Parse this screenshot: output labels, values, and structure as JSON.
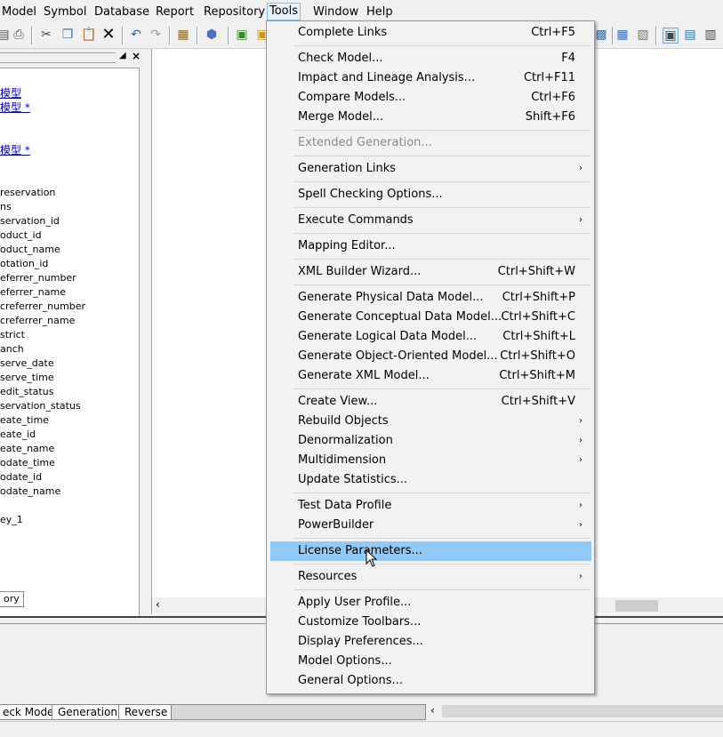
{
  "menubar": {
    "items": [
      "Model",
      "Symbol",
      "Database",
      "Report",
      "Repository",
      "Tools",
      "Window",
      "Help"
    ]
  },
  "left_panel": {
    "tree_items": [
      "模型",
      "模型 *",
      "模型 *",
      "reservation",
      "ns",
      "servation_id",
      "oduct_id",
      "oduct_name",
      "otation_id",
      "eferrer_number",
      "eferrer_name",
      "creferrer_number",
      "creferrer_name",
      "strict",
      "anch",
      "serve_date",
      "serve_time",
      "edit_status",
      "servation_status",
      "eate_time",
      "eate_id",
      "eate_name",
      "odate_time",
      "odate_id",
      "odate_name",
      "ey_1"
    ],
    "tab_label": "ory"
  },
  "bottom_tabs": [
    "eck Model",
    "Generation",
    "Reverse"
  ],
  "tools_menu": {
    "items": [
      {
        "label": "Complete Links",
        "shortcut": "Ctrl+F5"
      },
      {
        "label": "Check Model...",
        "shortcut": "F4"
      },
      {
        "label": "Impact and Lineage Analysis...",
        "shortcut": "Ctrl+F11"
      },
      {
        "label": "Compare Models...",
        "shortcut": "Ctrl+F6"
      },
      {
        "label": "Merge Model...",
        "shortcut": "Shift+F6"
      },
      {
        "label": "Extended Generation...",
        "shortcut": "",
        "disabled": true
      },
      {
        "label": "Generation Links",
        "shortcut": "",
        "submenu": true
      },
      {
        "label": "Spell Checking Options...",
        "shortcut": ""
      },
      {
        "label": "Execute Commands",
        "shortcut": "",
        "submenu": true
      },
      {
        "label": "Mapping Editor...",
        "shortcut": ""
      },
      {
        "label": "XML Builder Wizard...",
        "shortcut": "Ctrl+Shift+W"
      },
      {
        "label": "Generate Physical Data Model...",
        "shortcut": "Ctrl+Shift+P"
      },
      {
        "label": "Generate Conceptual Data Model...",
        "shortcut": "Ctrl+Shift+C"
      },
      {
        "label": "Generate Logical Data Model...",
        "shortcut": "Ctrl+Shift+L"
      },
      {
        "label": "Generate Object-Oriented Model...",
        "shortcut": "Ctrl+Shift+O"
      },
      {
        "label": "Generate XML Model...",
        "shortcut": "Ctrl+Shift+M"
      },
      {
        "label": "Create View...",
        "shortcut": "Ctrl+Shift+V"
      },
      {
        "label": "Rebuild Objects",
        "shortcut": "",
        "submenu": true
      },
      {
        "label": "Denormalization",
        "shortcut": "",
        "submenu": true
      },
      {
        "label": "Multidimension",
        "shortcut": "",
        "submenu": true
      },
      {
        "label": "Update Statistics...",
        "shortcut": ""
      },
      {
        "label": "Test Data Profile",
        "shortcut": "",
        "submenu": true
      },
      {
        "label": "PowerBuilder",
        "shortcut": "",
        "submenu": true
      },
      {
        "label": "License Parameters...",
        "shortcut": "",
        "highlighted": true
      },
      {
        "label": "Resources",
        "shortcut": "",
        "submenu": true
      },
      {
        "label": "Apply User Profile...",
        "shortcut": ""
      },
      {
        "label": "Customize Toolbars...",
        "shortcut": ""
      },
      {
        "label": "Display Preferences...",
        "shortcut": ""
      },
      {
        "label": "Model Options...",
        "shortcut": ""
      },
      {
        "label": "General Options...",
        "shortcut": ""
      }
    ],
    "submenu_arrow": "›"
  },
  "colors": {
    "highlight": "#91c9f7",
    "menu_bg": "#f2f2f2",
    "disabled_text": "#8a8a8a"
  }
}
